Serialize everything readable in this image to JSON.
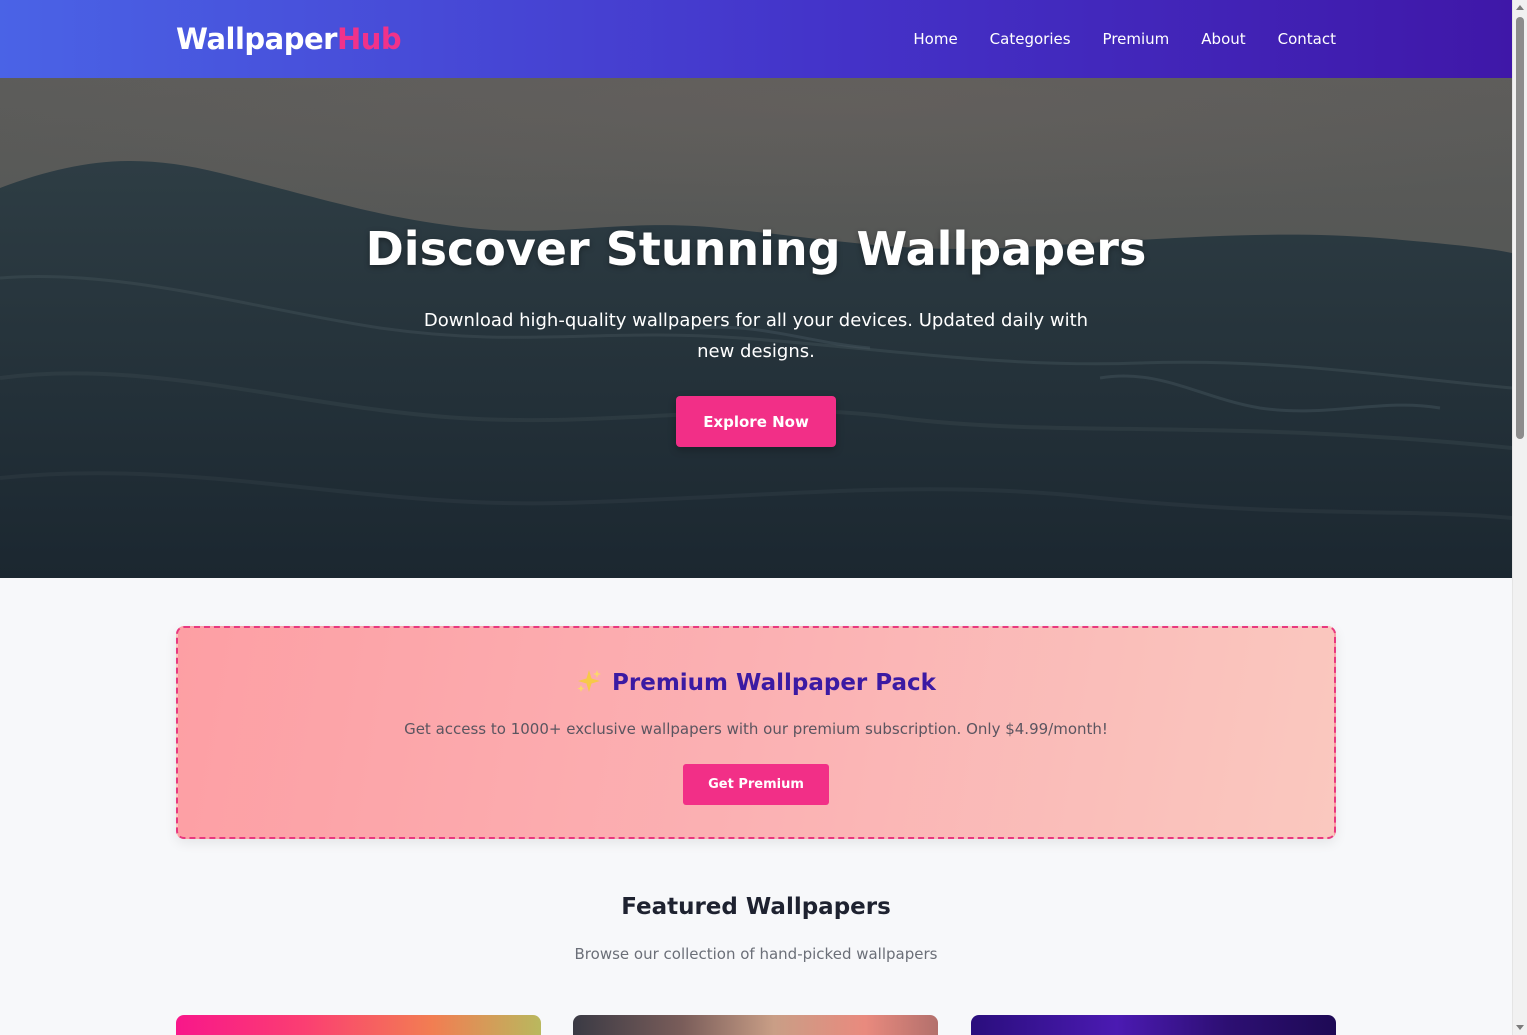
{
  "nav": {
    "logo_part1": "Wallpaper",
    "logo_part2": "Hub",
    "items": [
      "Home",
      "Categories",
      "Premium",
      "About",
      "Contact"
    ]
  },
  "hero": {
    "title": "Discover Stunning Wallpapers",
    "subtitle": "Download high-quality wallpapers for all your devices. Updated daily with new designs.",
    "cta": "Explore Now"
  },
  "premium": {
    "icon": "sparkles-icon",
    "title": "Premium Wallpaper Pack",
    "text": "Get access to 1000+ exclusive wallpapers with our premium subscription. Only $4.99/month!",
    "cta": "Get Premium"
  },
  "featured": {
    "title": "Featured Wallpapers",
    "subtitle": "Browse our collection of hand-picked wallpapers"
  },
  "colors": {
    "accent": "#f22f87",
    "nav_start": "#4a63e6",
    "nav_end": "#3f17a8",
    "premium_title": "#3b1aa3"
  }
}
